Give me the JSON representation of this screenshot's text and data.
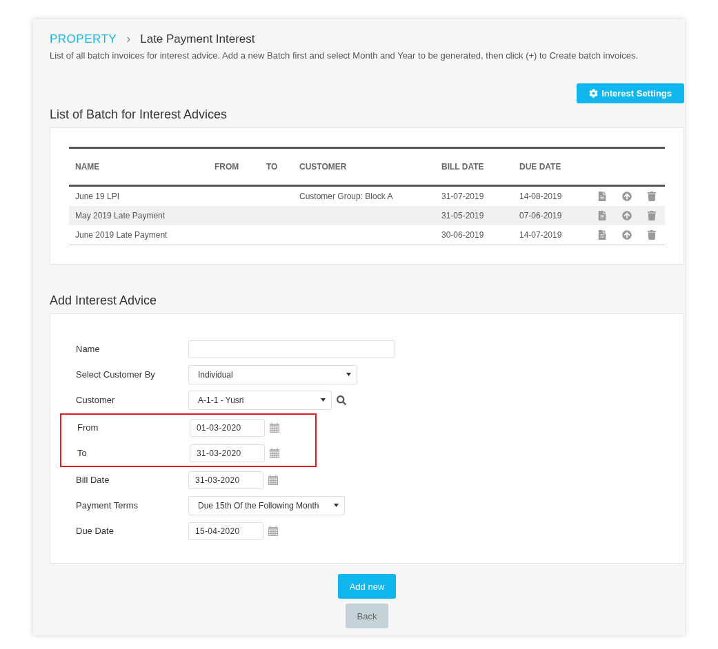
{
  "breadcrumb": {
    "root": "PROPERTY",
    "separator": "›",
    "current": "Late Payment Interest"
  },
  "description": "List of all batch invoices for interest advice. Add a new Batch first and select Month and Year to be generated, then click (+) to Create batch invoices.",
  "settings_button": "Interest Settings",
  "batch_list": {
    "title": "List of Batch for Interest Advices",
    "columns": [
      "NAME",
      "FROM",
      "TO",
      "CUSTOMER",
      "BILL DATE",
      "DUE DATE"
    ],
    "rows": [
      {
        "name": "June 19 LPI",
        "customer": "Customer Group: Block A",
        "bill_date": "31-07-2019",
        "due_date": "14-08-2019"
      },
      {
        "name": "May 2019 Late Payment",
        "bill_date": "31-05-2019",
        "due_date": "07-06-2019"
      },
      {
        "name": "June 2019 Late Payment",
        "bill_date": "30-06-2019",
        "due_date": "14-07-2019"
      }
    ]
  },
  "form": {
    "title": "Add Interest Advice",
    "fields": [
      {
        "label": "Name",
        "kind": "text",
        "highlighted": false
      },
      {
        "label": "Select Customer By",
        "kind": "select",
        "value": "Individual",
        "highlighted": false
      },
      {
        "label": "Customer",
        "kind": "select-search",
        "value": "A-1-1 - Yusri",
        "highlighted": false
      },
      {
        "label": "From",
        "kind": "date",
        "value": "01-03-2020",
        "highlighted": true
      },
      {
        "label": "To",
        "kind": "date",
        "value": "31-03-2020",
        "highlighted": true
      },
      {
        "label": "Bill Date",
        "kind": "date",
        "value": "31-03-2020",
        "highlighted": false
      },
      {
        "label": "Payment Terms",
        "kind": "select-wide",
        "value": "Due 15th Of the Following Month",
        "highlighted": false
      },
      {
        "label": "Due Date",
        "kind": "date",
        "value": "15-04-2020",
        "highlighted": false
      }
    ]
  },
  "buttons": [
    {
      "label": "Add new",
      "kind": "primary"
    },
    {
      "label": "Back",
      "kind": "secondary"
    }
  ]
}
